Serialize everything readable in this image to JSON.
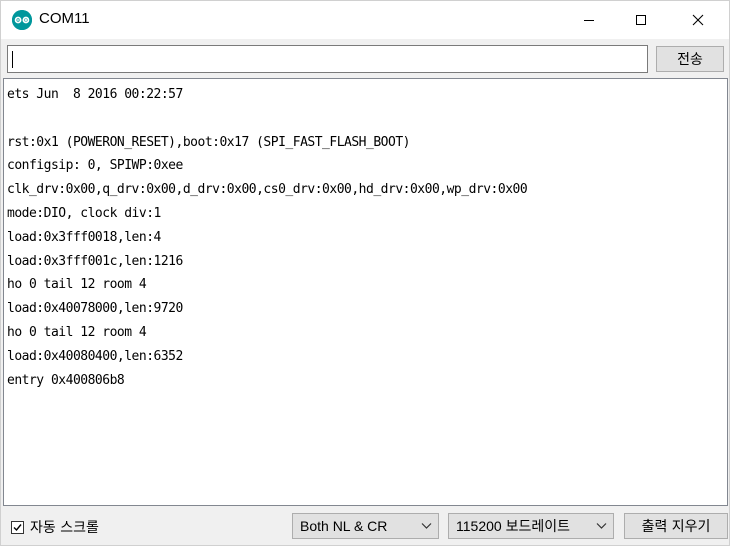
{
  "window": {
    "title": "COM11",
    "accent": "#00979c"
  },
  "send": {
    "input_value": "",
    "button_label": "전송"
  },
  "output": {
    "lines": [
      "ets Jun  8 2016 00:22:57",
      "",
      "rst:0x1 (POWERON_RESET),boot:0x17 (SPI_FAST_FLASH_BOOT)",
      "configsip: 0, SPIWP:0xee",
      "clk_drv:0x00,q_drv:0x00,d_drv:0x00,cs0_drv:0x00,hd_drv:0x00,wp_drv:0x00",
      "mode:DIO, clock div:1",
      "load:0x3fff0018,len:4",
      "load:0x3fff001c,len:1216",
      "ho 0 tail 12 room 4",
      "load:0x40078000,len:9720",
      "ho 0 tail 12 room 4",
      "load:0x40080400,len:6352",
      "entry 0x400806b8"
    ]
  },
  "footer": {
    "autoscroll_label": "자동 스크롤",
    "autoscroll_checked": true,
    "line_ending": "Both NL & CR",
    "baud_rate": "115200 보드레이트",
    "clear_label": "출력 지우기"
  }
}
